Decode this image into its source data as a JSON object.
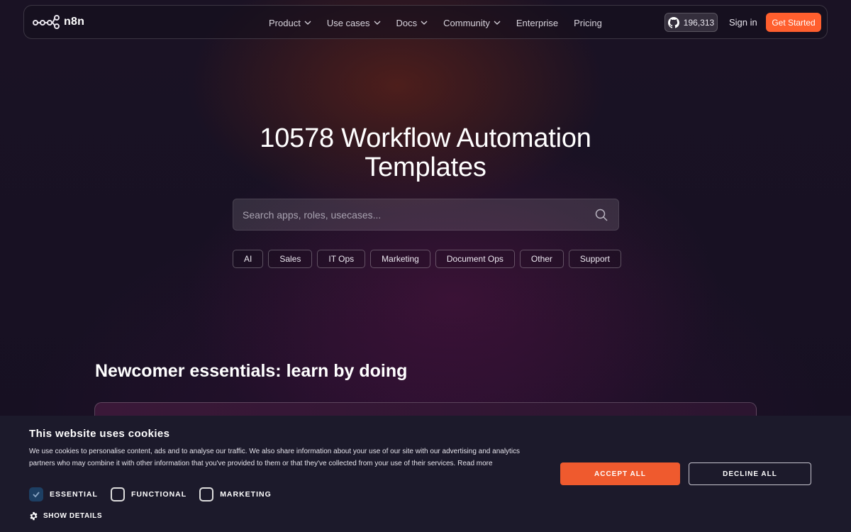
{
  "nav": {
    "logo_text": "n8n",
    "menu": [
      {
        "label": "Product",
        "dropdown": true
      },
      {
        "label": "Use cases",
        "dropdown": true
      },
      {
        "label": "Docs",
        "dropdown": true
      },
      {
        "label": "Community",
        "dropdown": true
      },
      {
        "label": "Enterprise",
        "dropdown": false
      },
      {
        "label": "Pricing",
        "dropdown": false
      }
    ],
    "github_stars": "196,313",
    "sign_in": "Sign in",
    "get_started": "Get Started"
  },
  "hero": {
    "title": "10578 Workflow Automation Templates",
    "search_placeholder": "Search apps, roles, usecases...",
    "chips": [
      "AI",
      "Sales",
      "IT Ops",
      "Marketing",
      "Document Ops",
      "Other",
      "Support"
    ]
  },
  "section": {
    "title": "Newcomer essentials: learn by doing"
  },
  "cookie": {
    "title": "This website uses cookies",
    "text": "We use cookies to personalise content, ads and to analyse our traffic. We also share information about your use of our site with our advertising and analytics partners who may combine it with other information that you've provided to them or that they've collected from your use of their services. Read more",
    "options": [
      {
        "label": "ESSENTIAL",
        "checked": true
      },
      {
        "label": "FUNCTIONAL",
        "checked": false
      },
      {
        "label": "MARKETING",
        "checked": false
      }
    ],
    "show_details": "SHOW DETAILS",
    "accept": "ACCEPT ALL",
    "decline": "DECLINE ALL"
  },
  "colors": {
    "accent": "#ff5f2e",
    "accept": "#ef5a2e",
    "checkbox_on": "#1d3f63",
    "cookie_bg": "#1c1a2b"
  }
}
